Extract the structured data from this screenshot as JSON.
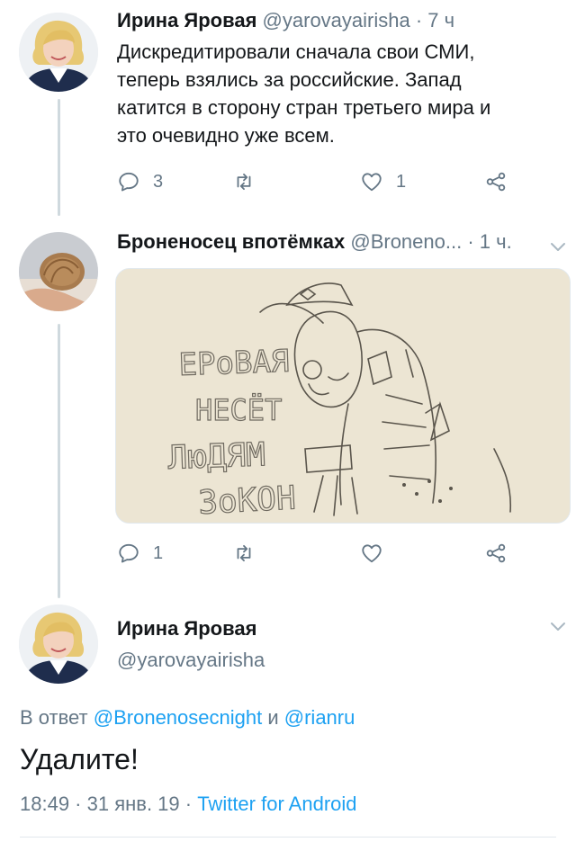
{
  "tweet1": {
    "author_name": "Ирина Яровая",
    "author_handle": "@yarovayairisha",
    "time": "· 7 ч",
    "text_lines": [
      "Дискредитировали сначала свои СМИ,",
      "теперь взялись за российские. Запад",
      "катится в сторону стран третьего  мира и",
      "это очевидно уже всем."
    ],
    "replies": "3",
    "likes": "1"
  },
  "tweet2": {
    "author_name": "Броненосец впотёмках",
    "author_handle": "@Broneno...",
    "time": "· 1 ч.",
    "image_text": [
      "ЕРоВАЯ",
      "НЕСЁТ",
      "ЛюДЯМ",
      "ЗоКОН"
    ],
    "replies": "1"
  },
  "main_tweet": {
    "author_name": "Ирина Яровая",
    "author_handle": "@yarovayairisha",
    "reply_prefix": "В ответ",
    "mention1": "@Bronenosecnight",
    "conj": "и",
    "mention2": "@rianru",
    "text": "Удалите!",
    "datetime": "18:49 · 31 янв. 19 ·",
    "source": "Twitter for Android"
  },
  "colors": {
    "accent": "#1da1f2",
    "muted": "#657786",
    "text": "#14171a"
  },
  "icons": [
    "reply-icon",
    "retweet-icon",
    "like-icon",
    "share-icon",
    "chevron-down-icon"
  ]
}
